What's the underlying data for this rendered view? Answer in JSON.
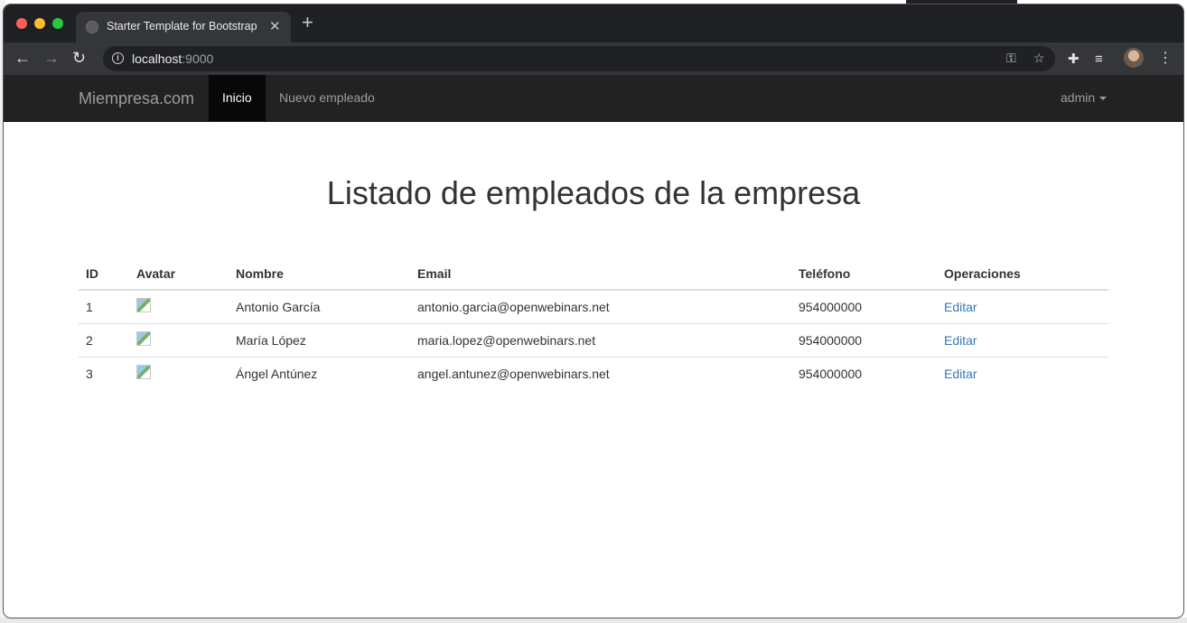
{
  "browser": {
    "tab_title": "Starter Template for Bootstrap",
    "url_host": "localhost",
    "url_port": ":9000"
  },
  "navbar": {
    "brand": "Miempresa.com",
    "items": [
      {
        "label": "Inicio",
        "active": true
      },
      {
        "label": "Nuevo empleado",
        "active": false
      }
    ],
    "user": "admin"
  },
  "main": {
    "title": "Listado de empleados de la empresa",
    "table": {
      "headers": [
        "ID",
        "Avatar",
        "Nombre",
        "Email",
        "Teléfono",
        "Operaciones"
      ],
      "rows": [
        {
          "id": "1",
          "name": "Antonio García",
          "email": "antonio.garcia@openwebinars.net",
          "phone": "954000000",
          "action": "Editar"
        },
        {
          "id": "2",
          "name": "María López",
          "email": "maria.lopez@openwebinars.net",
          "phone": "954000000",
          "action": "Editar"
        },
        {
          "id": "3",
          "name": "Ángel Antúnez",
          "email": "angel.antunez@openwebinars.net",
          "phone": "954000000",
          "action": "Editar"
        }
      ]
    }
  },
  "colors": {
    "navbar_bg": "#222222",
    "link": "#337ab7"
  }
}
